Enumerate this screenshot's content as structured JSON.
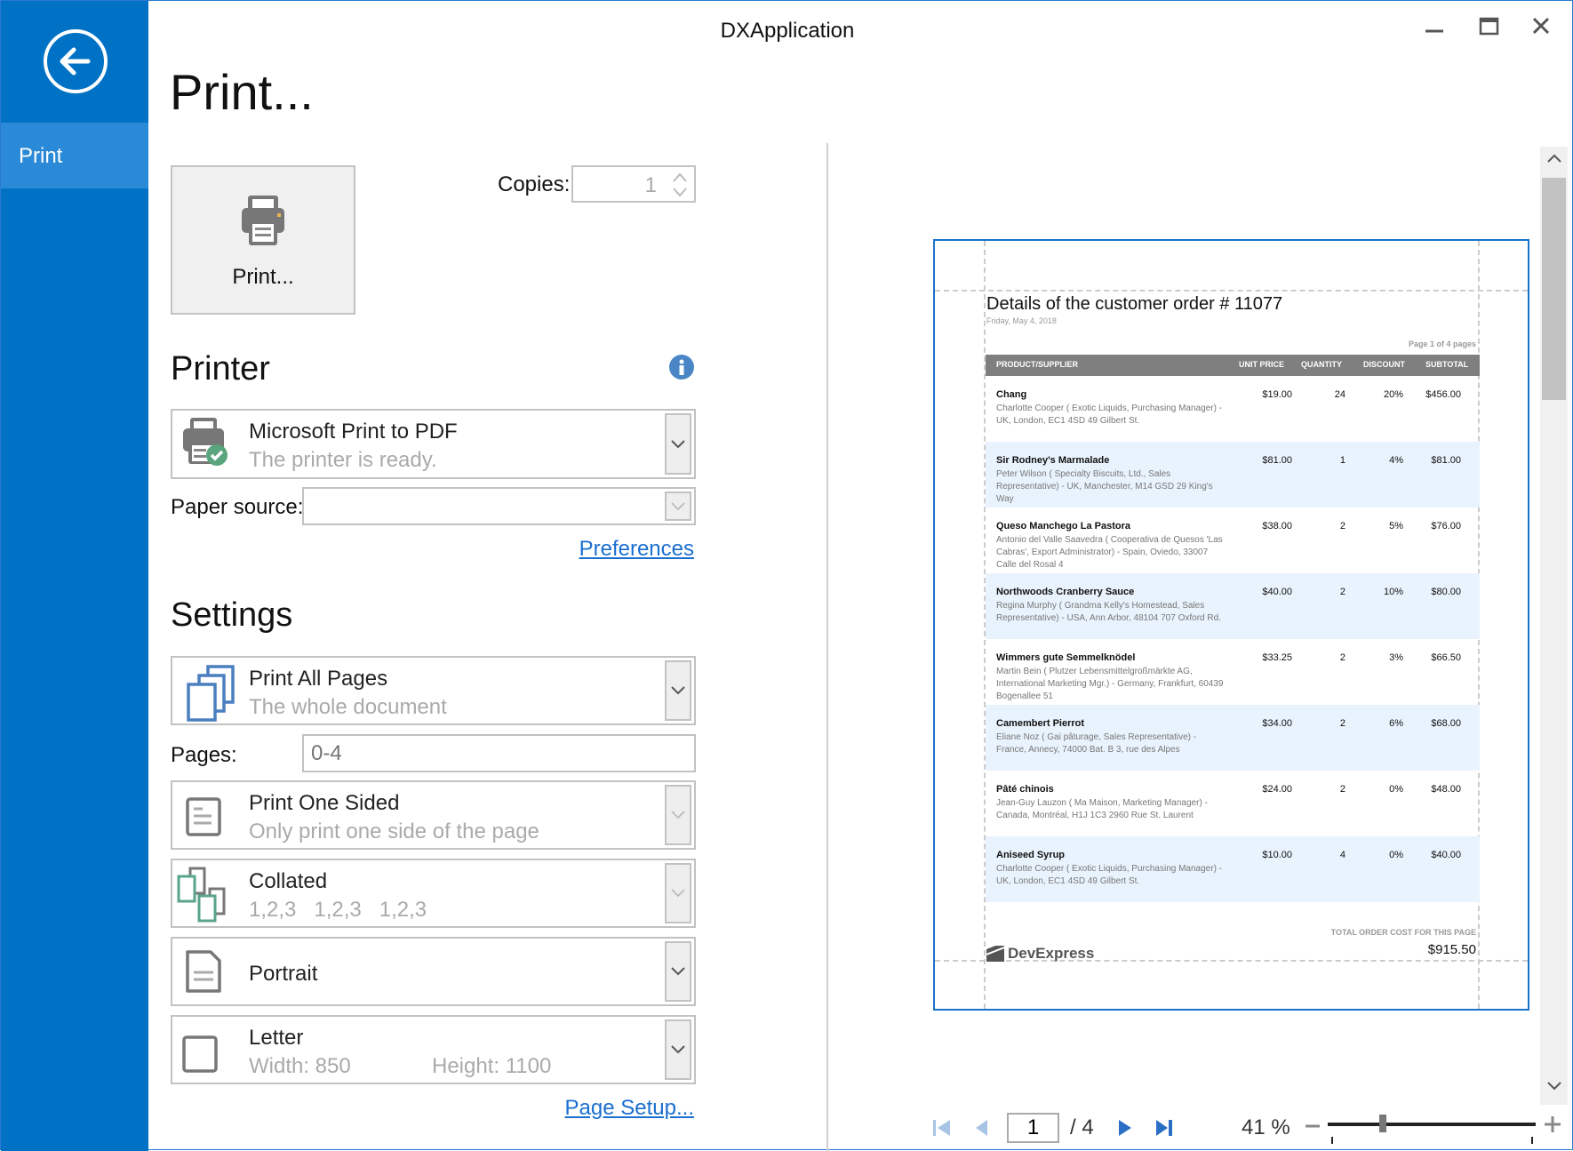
{
  "app": {
    "title": "DXApplication"
  },
  "sidebar": {
    "back_icon": "arrow-left-circle-icon",
    "items": [
      {
        "label": "Print"
      }
    ]
  },
  "main": {
    "title": "Print...",
    "print_button": "Print...",
    "copies_label": "Copies:",
    "copies_value": "1"
  },
  "printer": {
    "heading": "Printer",
    "name": "Microsoft Print to PDF",
    "status": "The printer is ready.",
    "paper_source_label": "Paper source:",
    "paper_source_value": "",
    "preferences_link": "Preferences"
  },
  "settings": {
    "heading": "Settings",
    "pages_option": {
      "title": "Print All Pages",
      "subtitle": "The whole document"
    },
    "pages_label": "Pages:",
    "pages_placeholder": "0-4",
    "sided": {
      "title": "Print One Sided",
      "subtitle": "Only print one side of the page"
    },
    "collation": {
      "title": "Collated",
      "subtitle": "1,2,3   1,2,3   1,2,3"
    },
    "orientation": {
      "title": "Portrait"
    },
    "paper": {
      "title": "Letter",
      "width": "Width: 850",
      "height": "Height: 1100"
    },
    "page_setup_link": "Page Setup..."
  },
  "preview": {
    "doc_title": "Details of the customer order # 11077",
    "date": "Friday, May 4, 2018",
    "page_info": "Page 1 of 4 pages",
    "columns": [
      "PRODUCT/SUPPLIER",
      "UNIT PRICE",
      "QUANTITY",
      "DISCOUNT",
      "SUBTOTAL"
    ],
    "rows": [
      {
        "product": "Chang",
        "supplier": "Charlotte Cooper ( Exotic Liquids, Purchasing Manager)  -  UK, London, EC1 4SD  49 Gilbert St.",
        "price": "$19.00",
        "qty": "24",
        "discount": "20%",
        "subtotal": "$456.00"
      },
      {
        "product": "Sir Rodney's Marmalade",
        "supplier": "Peter Wilson ( Specialty Biscuits, Ltd., Sales Representative)  -  UK, Manchester, M14 GSD  29 King's Way",
        "price": "$81.00",
        "qty": "1",
        "discount": "4%",
        "subtotal": "$81.00"
      },
      {
        "product": "Queso Manchego La Pastora",
        "supplier": "Antonio del Valle Saavedra ( Cooperativa de Quesos 'Las Cabras', Export Administrator)  -  Spain, Oviedo, 33007  Calle del Rosal 4",
        "price": "$38.00",
        "qty": "2",
        "discount": "5%",
        "subtotal": "$76.00"
      },
      {
        "product": "Northwoods Cranberry Sauce",
        "supplier": "Regina Murphy ( Grandma Kelly's Homestead, Sales Representative)  -  USA, Ann Arbor, 48104  707 Oxford Rd.",
        "price": "$40.00",
        "qty": "2",
        "discount": "10%",
        "subtotal": "$80.00"
      },
      {
        "product": "Wimmers gute Semmelknödel",
        "supplier": "Martin Bein ( Plutzer Lebensmittelgroßmärkte AG, International Marketing Mgr.)  -  Germany, Frankfurt, 60439  Bogenallee 51",
        "price": "$33.25",
        "qty": "2",
        "discount": "3%",
        "subtotal": "$66.50"
      },
      {
        "product": "Camembert Pierrot",
        "supplier": "Eliane Noz ( Gai pâturage, Sales Representative)  -  France, Annecy, 74000  Bat. B 3, rue des Alpes",
        "price": "$34.00",
        "qty": "2",
        "discount": "6%",
        "subtotal": "$68.00"
      },
      {
        "product": "Pâté chinois",
        "supplier": "Jean-Guy Lauzon ( Ma Maison, Marketing Manager)  -  Canada, Montréal, H1J 1C3  2960 Rue St. Laurent",
        "price": "$24.00",
        "qty": "2",
        "discount": "0%",
        "subtotal": "$48.00"
      },
      {
        "product": "Aniseed Syrup",
        "supplier": "Charlotte Cooper ( Exotic Liquids, Purchasing Manager)  -  UK, London, EC1 4SD  49 Gilbert St.",
        "price": "$10.00",
        "qty": "4",
        "discount": "0%",
        "subtotal": "$40.00"
      }
    ],
    "total_label": "TOTAL ORDER COST FOR THIS PAGE",
    "total_value": "$915.50",
    "logo": "DevExpress"
  },
  "navigation": {
    "current_page": "1",
    "total_pages": "/ 4",
    "zoom": "41 %",
    "zoom_percent": 41
  },
  "colors": {
    "accent": "#0072c6",
    "sidebar_selected": "#2b8ad8",
    "link": "#1a6fd0",
    "alt_row": "#e9f3fd",
    "header_row": "#7f7f7f"
  }
}
